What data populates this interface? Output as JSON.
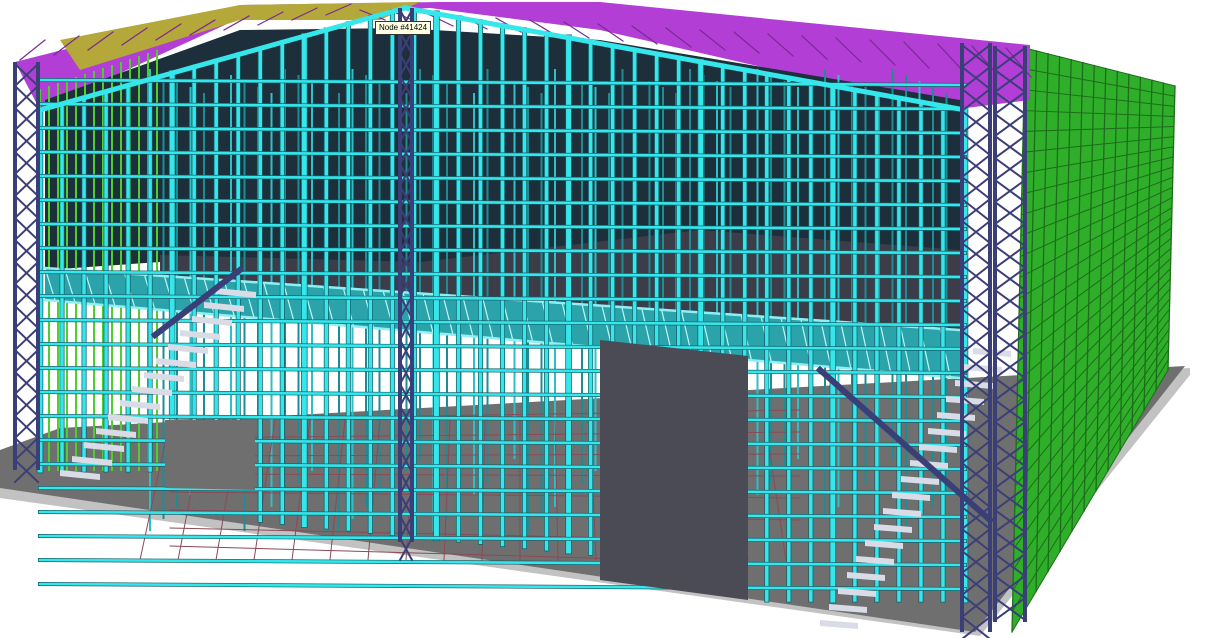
{
  "viewport": {
    "tooltip_text": "Node #41424",
    "model_colors": {
      "background": "#ffffff",
      "ground_slab": "#6f6f6f",
      "ground_edge": "#c2c2c2",
      "front_frame": "#35e6ea",
      "front_frame_outline": "#15606a",
      "roof_bracing": "#b23ed6",
      "roof_purlins": "#b5a83a",
      "side_wall": "#2fae2a",
      "side_wall_dark": "#1d6d1b",
      "corner_columns": "#3b3f78",
      "inner_green_columns": "#4fcf2f",
      "interior_dark": "#2b2d3a",
      "mezzanine_floor": "#3c3d48",
      "stairs": "#d9dbe6",
      "floor_grid": "#8a4a56"
    }
  }
}
